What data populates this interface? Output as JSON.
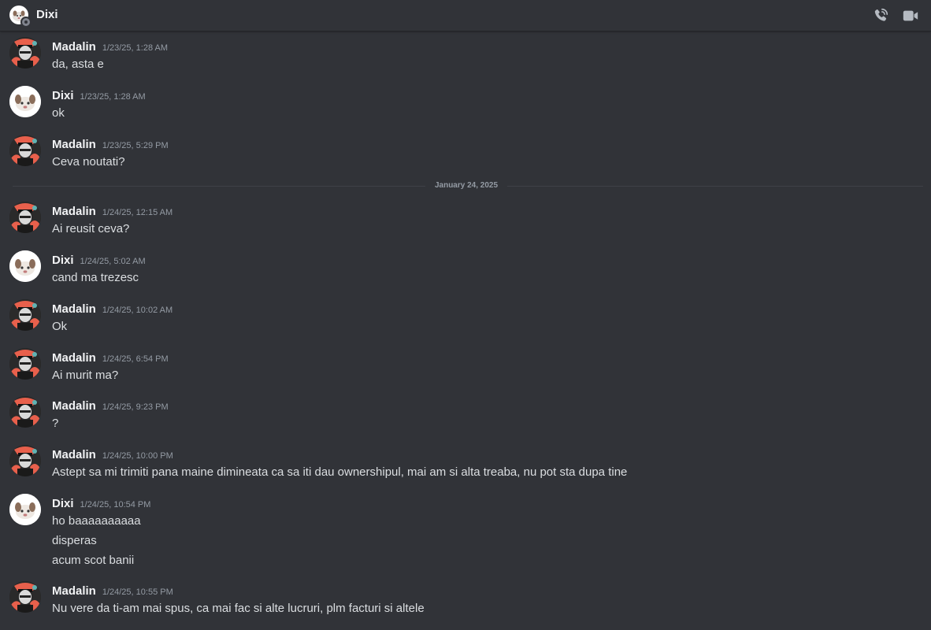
{
  "header": {
    "title": "Dixi",
    "call_icon": "phone-call-icon",
    "video_icon": "video-camera-icon"
  },
  "colors": {
    "background": "#313338",
    "author_name": "#f2f3f5",
    "message_text": "#dbdee1",
    "timestamp": "#949ba4",
    "divider": "#3f4147"
  },
  "messages": [
    {
      "author": "Madalin",
      "time": "1/23/25, 1:28 AM",
      "lines": [
        "da, asta e"
      ]
    },
    {
      "author": "Dixi",
      "time": "1/23/25, 1:28 AM",
      "lines": [
        "ok"
      ]
    },
    {
      "author": "Madalin",
      "time": "1/23/25, 5:29 PM",
      "lines": [
        "Ceva noutati?"
      ]
    },
    {
      "author": "Madalin",
      "time": "1/24/25, 12:15 AM",
      "lines": [
        "Ai reusit ceva?"
      ]
    },
    {
      "author": "Dixi",
      "time": "1/24/25, 5:02 AM",
      "lines": [
        "cand ma trezesc"
      ]
    },
    {
      "author": "Madalin",
      "time": "1/24/25, 10:02 AM",
      "lines": [
        "Ok"
      ]
    },
    {
      "author": "Madalin",
      "time": "1/24/25, 6:54 PM",
      "lines": [
        "Ai murit ma?"
      ]
    },
    {
      "author": "Madalin",
      "time": "1/24/25, 9:23 PM",
      "lines": [
        "?"
      ]
    },
    {
      "author": "Madalin",
      "time": "1/24/25, 10:00 PM",
      "lines": [
        "Astept sa mi trimiti pana maine dimineata ca sa iti dau ownershipul, mai am si alta treaba, nu pot sta dupa tine"
      ]
    },
    {
      "author": "Dixi",
      "time": "1/24/25, 10:54 PM",
      "lines": [
        "ho baaaaaaaaaa",
        "disperas",
        "acum scot banii"
      ]
    },
    {
      "author": "Madalin",
      "time": "1/24/25, 10:55 PM",
      "lines": [
        "Nu vere da ti-am mai spus, ca mai fac si alte lucruri, plm facturi si altele"
      ]
    }
  ],
  "date_divider": {
    "label": "January 24, 2025"
  }
}
